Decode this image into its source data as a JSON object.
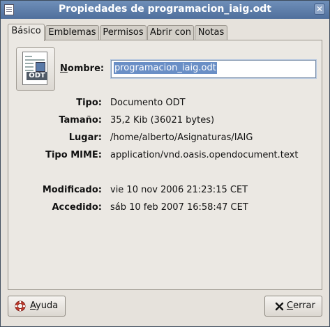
{
  "window": {
    "title": "Propiedades de programacion_iaig.odt"
  },
  "tabs": [
    {
      "label": "Básico",
      "active": true
    },
    {
      "label": "Emblemas",
      "active": false
    },
    {
      "label": "Permisos",
      "active": false
    },
    {
      "label": "Abrir con",
      "active": false
    },
    {
      "label": "Notas",
      "active": false
    }
  ],
  "file_icon": {
    "badge": "ODT",
    "icon": "odt-document-icon"
  },
  "name": {
    "label_mnemonic": "N",
    "label_rest": "ombre:",
    "value": "programacion_iaig.odt"
  },
  "properties": [
    {
      "label": "Tipo:",
      "value": "Documento ODT"
    },
    {
      "label": "Tamaño:",
      "value": "35,2 Kib (36021 bytes)"
    },
    {
      "label": "Lugar:",
      "value": "/home/alberto/Asignaturas/IAIG"
    },
    {
      "label": "Tipo MIME:",
      "value": "application/vnd.oasis.opendocument.text"
    },
    {
      "label": "Modificado:",
      "value": "vie 10 nov 2006 21:23:15 CET"
    },
    {
      "label": "Accedido:",
      "value": "sáb 10 feb 2007 16:58:47 CET"
    }
  ],
  "buttons": {
    "help": {
      "mnemonic": "A",
      "rest": "yuda",
      "icon": "lifebuoy-icon"
    },
    "close": {
      "mnemonic": "C",
      "rest": "errar",
      "icon": "close-x-icon"
    }
  },
  "colors": {
    "titlebar": "#5b7aa6",
    "selection": "#6a8fc6",
    "help_icon": "#c0392b"
  }
}
